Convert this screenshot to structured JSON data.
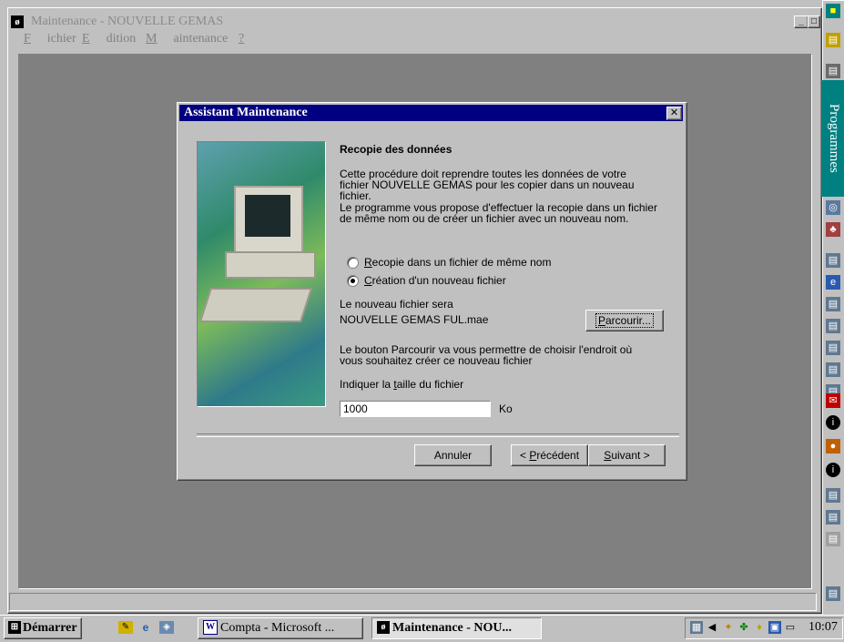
{
  "main_window": {
    "title": "Maintenance - NOUVELLE GEMAS",
    "menu": [
      "Fichier",
      "Edition",
      "Maintenance",
      "?"
    ]
  },
  "sidebar": {
    "label": "Programmes"
  },
  "dialog": {
    "title": "Assistant Maintenance",
    "heading": "Recopie des données",
    "paragraph_lines": [
      "Cette procédure doit reprendre toutes les données de votre",
      "fichier NOUVELLE GEMAS pour les copier dans un nouveau",
      "fichier.",
      "Le programme vous propose d'effectuer la recopie dans un fichier",
      "de même nom ou de créer un fichier avec un nouveau nom."
    ],
    "options": [
      {
        "label": "Recopie dans un fichier de même nom",
        "selected": false
      },
      {
        "label": "Création d'un nouveau fichier",
        "selected": true
      }
    ],
    "new_file_label": "Le nouveau fichier sera",
    "new_file_name": "NOUVELLE GEMAS FUL.mae",
    "browse_label": "Parcourir...",
    "hint_lines": [
      "Le bouton Parcourir va vous permettre de choisir l'endroit où",
      "vous souhaitez créer ce nouveau fichier"
    ],
    "size_label": "Indiquer la taille du fichier",
    "size_value": "1000",
    "size_unit": "Ko",
    "cancel_label": "Annuler",
    "previous_label": "< Précédent",
    "next_label": "Suivant >"
  },
  "taskbar": {
    "start_label": "Démarrer",
    "tasks": [
      "Compta - Microsoft ...",
      "Maintenance - NOU..."
    ],
    "active_task": 1,
    "clock": "10:07"
  }
}
